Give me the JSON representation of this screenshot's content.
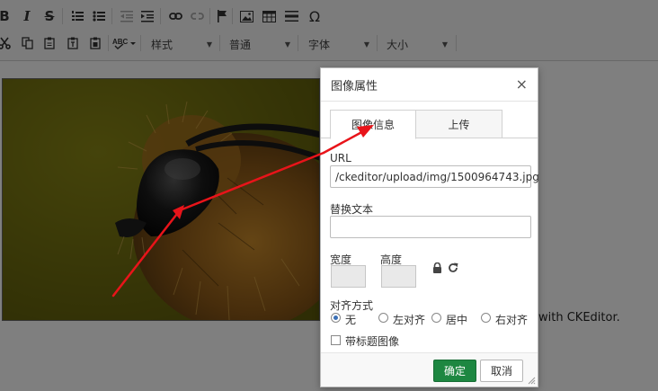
{
  "toolbar": {
    "row1_icons": [
      "bold-icon",
      "italic-icon",
      "strikethrough-icon",
      "numbered-list-icon",
      "bulleted-list-icon",
      "outdent-icon",
      "indent-icon",
      "link-icon",
      "unlink-icon",
      "anchor-icon",
      "image-icon",
      "table-icon",
      "horizontal-line-icon",
      "special-char-icon"
    ],
    "bold_glyph": "B",
    "italic_glyph": "I",
    "strike_glyph": "S",
    "omega_glyph": "Ω",
    "combos": {
      "style": "样式",
      "format": "普通",
      "font": "字体",
      "size": "大小"
    }
  },
  "content": {
    "tail_text": "with CKEditor."
  },
  "dialog": {
    "title": "图像属性",
    "close": "×",
    "tabs": [
      {
        "label": "图像信息",
        "active": true
      },
      {
        "label": "上传",
        "active": false
      }
    ],
    "url_label": "URL",
    "url_value": "/ckeditor/upload/img/1500964743.jpg",
    "alt_label": "替换文本",
    "alt_value": "",
    "width_label": "宽度",
    "height_label": "高度",
    "align_label": "对齐方式",
    "align_options": [
      {
        "label": "无",
        "selected": true
      },
      {
        "label": "左对齐",
        "selected": false
      },
      {
        "label": "居中",
        "selected": false
      },
      {
        "label": "右对齐",
        "selected": false
      }
    ],
    "caption_label": "带标题图像",
    "caption_checked": false,
    "ok_label": "确定",
    "cancel_label": "取消"
  },
  "colors": {
    "ok_button": "#1d8741",
    "annotation_arrow": "#e8141a",
    "radio_dot": "#3a6fb5"
  }
}
